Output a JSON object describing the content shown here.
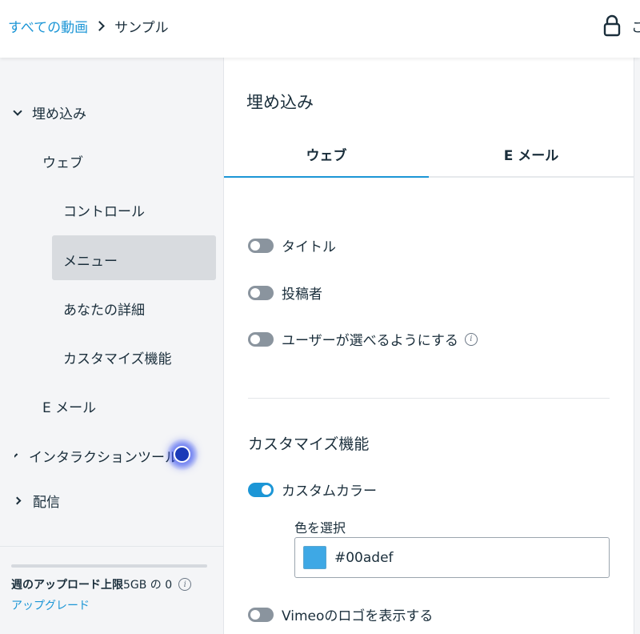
{
  "breadcrumb": {
    "root": "すべての動画",
    "current": "サンプル"
  },
  "topbar": {
    "partial_text": "こ"
  },
  "sidebar": {
    "items": [
      {
        "label": "埋め込み"
      },
      {
        "label": "ウェブ"
      },
      {
        "label": "コントロール"
      },
      {
        "label": "メニュー"
      },
      {
        "label": "あなたの詳細"
      },
      {
        "label": "カスタマイズ機能"
      },
      {
        "label": "E メール"
      },
      {
        "label": "インタラクションツール"
      },
      {
        "label": "配信"
      }
    ],
    "footer": {
      "quota_label": "週のアップロード上限",
      "quota_value": "5GB の 0",
      "upgrade": "アップグレード"
    }
  },
  "panel": {
    "title": "埋め込み",
    "tabs": [
      {
        "label": "ウェブ"
      },
      {
        "label": "E メール"
      }
    ],
    "toggles": [
      {
        "label": "タイトル",
        "on": false
      },
      {
        "label": "投稿者",
        "on": false
      },
      {
        "label": "ユーザーが選べるようにする",
        "on": false
      }
    ],
    "customize": {
      "title": "カスタマイズ機能",
      "custom_color_label": "カスタムカラー",
      "custom_color_on": true,
      "pick_color_label": "色を選択",
      "color_value": "#00adef",
      "logo_label": "Vimeoのロゴを表示する",
      "logo_on": false
    }
  },
  "colors": {
    "accent": "#1c96d6",
    "swatch": "#3ea8e5"
  }
}
